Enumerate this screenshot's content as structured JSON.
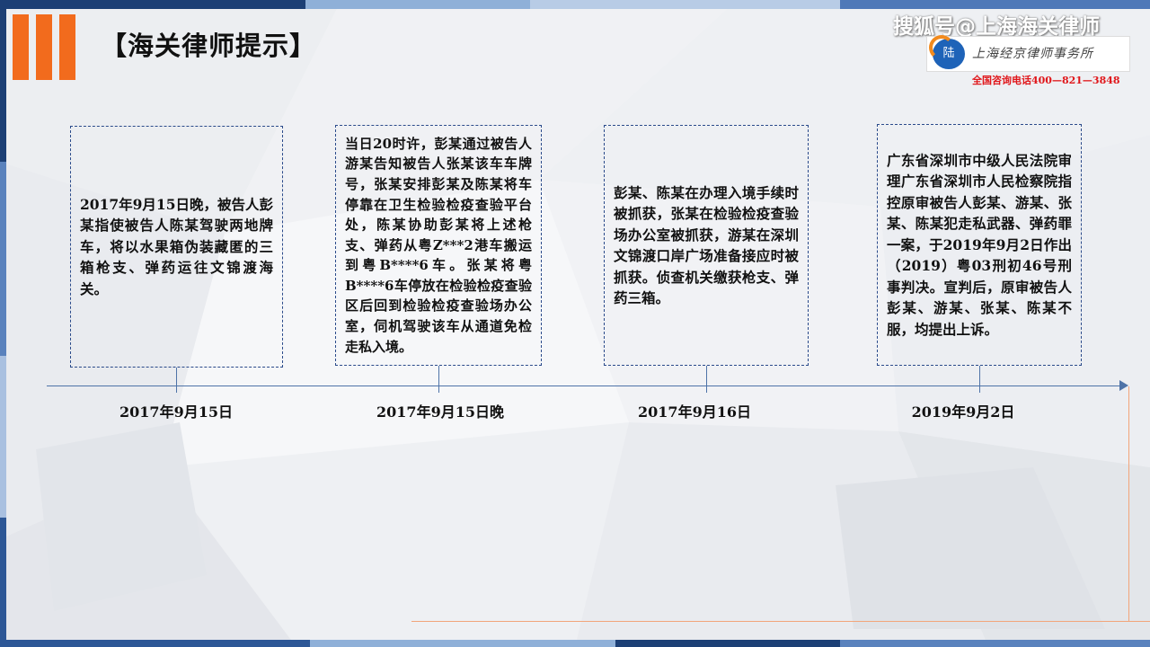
{
  "title": "【海关律师提示】",
  "watermark": "搜狐号@上海海关律师",
  "logo": {
    "mark_text": "陆",
    "text": "上海经京律师事务所"
  },
  "phone": "全国咨询电话400—821—3848",
  "colors": {
    "accent": "#f26b1d",
    "timeline": "#4e73a8",
    "card_border": "#2a4a8a"
  },
  "events": [
    {
      "date": "2017年9月15日",
      "text": "2017年9月15日晚，被告人彭某指使被告人陈某驾驶两地牌车，将以水果箱伪装藏匿的三箱枪支、弹药运往文锦渡海关。"
    },
    {
      "date": "2017年9月15日晚",
      "text": "当日20时许，彭某通过被告人游某告知被告人张某该车车牌号，张某安排彭某及陈某将车停靠在卫生检验检疫查验平台处，陈某协助彭某将上述枪支、弹药从粤Z***2港车搬运到粤B****6车。张某将粤B****6车停放在检验检疫查验区后回到检验检疫查验场办公室，伺机驾驶该车从通道免检走私入境。"
    },
    {
      "date": "2017年9月16日",
      "text": "彭某、陈某在办理入境手续时被抓获，张某在检验检疫查验场办公室被抓获，游某在深圳文锦渡口岸广场准备接应时被抓获。侦查机关缴获枪支、弹药三箱。"
    },
    {
      "date": "2019年9月2日",
      "text": "广东省深圳市中级人民法院审理广东省深圳市人民检察院指控原审被告人彭某、游某、张某、陈某犯走私武器、弹药罪一案，于2019年9月2日作出（2019）粤03刑初46号刑事判决。宣判后，原审被告人彭某、游某、张某、陈某不服，均提出上诉。"
    }
  ]
}
